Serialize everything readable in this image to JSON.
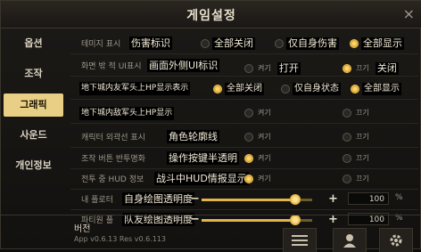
{
  "window": {
    "title": "게임설정",
    "close": "×"
  },
  "sidebar": {
    "tabs": [
      {
        "label": "옵션",
        "active": false
      },
      {
        "label": "조작",
        "active": false
      },
      {
        "label": "그래픽",
        "active": true
      },
      {
        "label": "사운드",
        "active": false
      },
      {
        "label": "개인정보",
        "active": false
      }
    ]
  },
  "settings": {
    "damage": {
      "label": "테미지 표시",
      "overlay": "伤害标识",
      "options": [
        {
          "label": "全部关闭",
          "selected": false
        },
        {
          "label": "仅自身伤害",
          "selected": false
        },
        {
          "label": "全部显示",
          "selected": true
        }
      ]
    },
    "screen_ui": {
      "label": "화면 밖 적 UI표시",
      "overlay": "画面外侧UI标识",
      "options": [
        {
          "sub": "켜기",
          "label": "打开",
          "selected": false
        },
        {
          "sub": "끄기",
          "label": "关闭",
          "selected": true
        }
      ]
    },
    "dungeon_ally_hp": {
      "overlay": "地下城内友军头上HP显示表示",
      "options": [
        {
          "label": "全部关闭",
          "selected": true
        },
        {
          "label": "仅自身状态",
          "selected": false
        },
        {
          "label": "全部显示",
          "selected": true
        }
      ]
    },
    "dungeon_enemy_hp": {
      "overlay": "地下城内敌军头上HP显示",
      "options": [
        {
          "label": "켜기",
          "selected": false
        },
        {
          "label": "끄기",
          "selected": false
        }
      ]
    },
    "outline": {
      "label": "캐릭터 외곽선 표시",
      "overlay": "角色轮廓线",
      "options": [
        {
          "label": "켜기",
          "selected": false
        },
        {
          "label": "끄기",
          "selected": false
        }
      ]
    },
    "button_transparency": {
      "label": "조작 버튼 반투명화",
      "overlay": "操作按键半透明",
      "options": [
        {
          "label": "켜기",
          "selected": true
        },
        {
          "label": "끄기",
          "selected": false
        }
      ]
    },
    "battle_hud": {
      "label": "전투 중 HUD 정보",
      "overlay": "战斗中HUD情报显示",
      "options": [
        {
          "label": "켜기",
          "selected": true
        },
        {
          "label": "끄기",
          "selected": false
        }
      ]
    },
    "self_drawing": {
      "label": "내 플로터",
      "overlay": "自身绘图透明度",
      "value": "100",
      "percent": 0.85,
      "unit": "%"
    },
    "party_drawing": {
      "label": "파티원 플",
      "overlay": "队友绘图透明度",
      "value": "100",
      "percent": 0.85,
      "unit": "%"
    }
  },
  "footer": {
    "version_title": "버전",
    "version": "App v0.6.13  Res v0.6.113"
  },
  "icons": {
    "close": "close-icon",
    "list": "list-icon",
    "user": "user-icon",
    "gear": "gear-icon"
  }
}
